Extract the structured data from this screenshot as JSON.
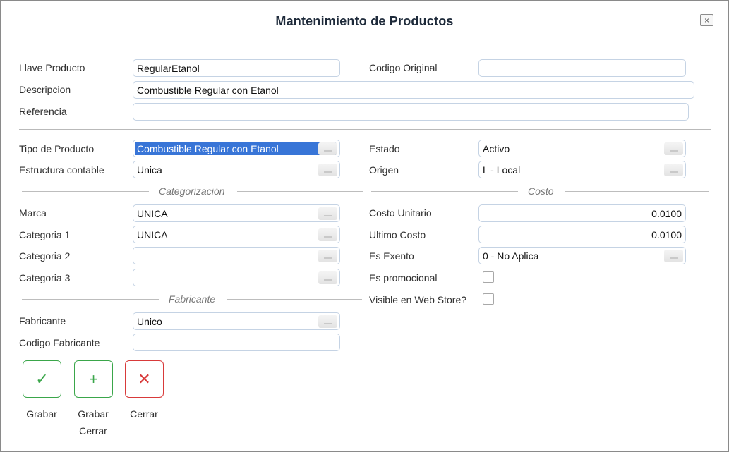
{
  "dialog": {
    "title": "Mantenimiento de Productos",
    "close_glyph": "×"
  },
  "icons": {
    "close": "close-icon",
    "grabar": "check-icon",
    "grabar_cerrar": "plus-icon",
    "cerrar": "x-icon"
  },
  "colors": {
    "accent_green": "#3aa64a",
    "accent_red": "#d83a3a",
    "selection_blue": "#3875d7",
    "field_border": "#c5d3e4"
  },
  "fields": {
    "llave_producto": {
      "label": "Llave Producto",
      "value": "RegularEtanol"
    },
    "codigo_original": {
      "label": "Codigo Original",
      "value": ""
    },
    "descripcion": {
      "label": "Descripcion",
      "value": "Combustible Regular con Etanol"
    },
    "referencia": {
      "label": "Referencia",
      "value": ""
    },
    "tipo_producto": {
      "label": "Tipo de Producto",
      "value": "Combustible Regular con Etanol"
    },
    "estado": {
      "label": "Estado",
      "value": "Activo"
    },
    "estructura_contable": {
      "label": "Estructura contable",
      "value": "Unica"
    },
    "origen": {
      "label": "Origen",
      "value": "L - Local"
    },
    "marca": {
      "label": "Marca",
      "value": "UNICA"
    },
    "categoria1": {
      "label": "Categoria 1",
      "value": "UNICA"
    },
    "categoria2": {
      "label": "Categoria 2",
      "value": ""
    },
    "categoria3": {
      "label": "Categoria 3",
      "value": ""
    },
    "costo_unitario": {
      "label": "Costo Unitario",
      "value": "0.0100"
    },
    "ultimo_costo": {
      "label": "Ultimo Costo",
      "value": "0.0100"
    },
    "es_exento": {
      "label": "Es Exento",
      "value": "0 - No Aplica"
    },
    "es_promocional": {
      "label": "Es promocional",
      "checked": false
    },
    "visible_web_store": {
      "label": "Visible en Web Store?",
      "checked": false
    },
    "fabricante": {
      "label": "Fabricante",
      "value": "Unico"
    },
    "codigo_fabricante": {
      "label": "Codigo Fabricante",
      "value": ""
    }
  },
  "sections": {
    "categorizacion": "Categorización",
    "costo": "Costo",
    "fabricante": "Fabricante"
  },
  "actions": {
    "grabar": {
      "glyph": "✓",
      "label": "Grabar"
    },
    "grabar_cerrar": {
      "glyph": "+",
      "label_line1": "Grabar",
      "label_line2": "Cerrar"
    },
    "cerrar": {
      "glyph": "✕",
      "label": "Cerrar"
    }
  }
}
